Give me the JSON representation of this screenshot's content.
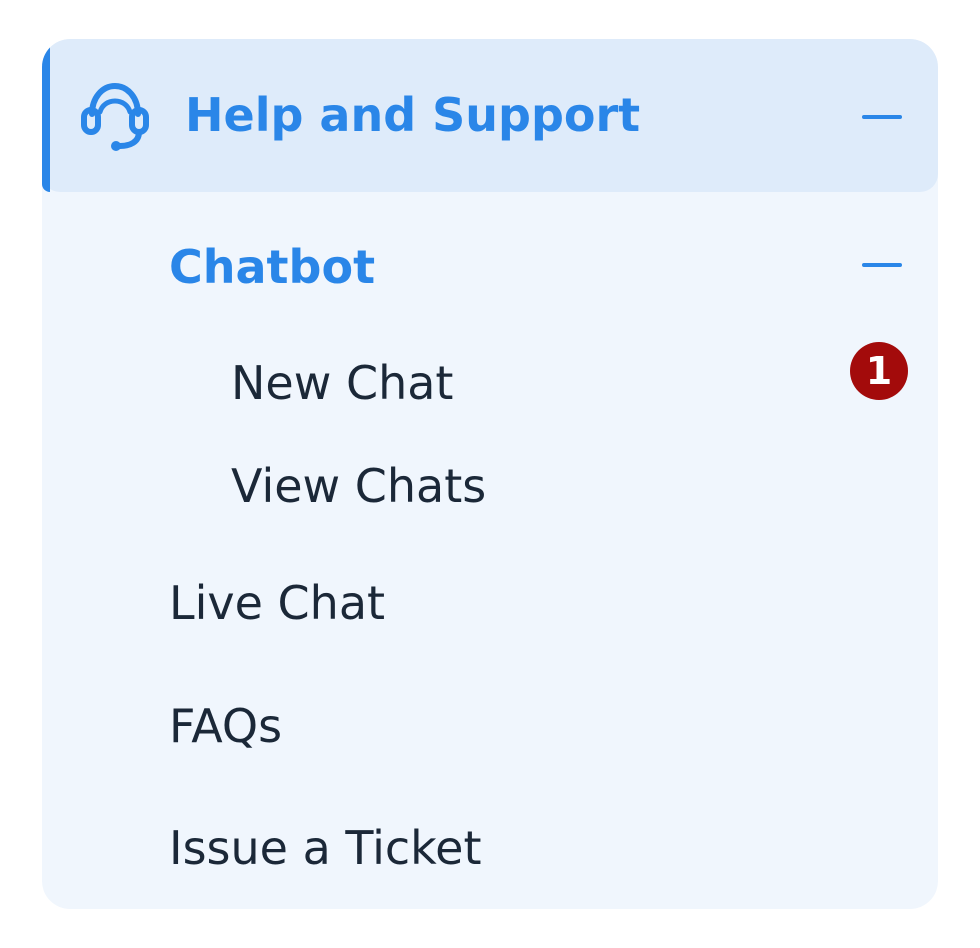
{
  "menu": {
    "header": {
      "title": "Help and Support",
      "icon": "headset-icon",
      "expanded": true
    },
    "chatbot": {
      "label": "Chatbot",
      "expanded": true,
      "items": [
        {
          "label": "New Chat",
          "badge": "1"
        },
        {
          "label": "View Chats"
        }
      ]
    },
    "items": [
      {
        "label": "Live Chat"
      },
      {
        "label": "FAQs"
      },
      {
        "label": "Issue a Ticket"
      }
    ]
  },
  "colors": {
    "accent": "#2a86e8",
    "header_bg": "#deebfa",
    "panel_bg": "#f0f6fd",
    "text": "#1b2838",
    "badge_bg": "#a30b0b"
  }
}
